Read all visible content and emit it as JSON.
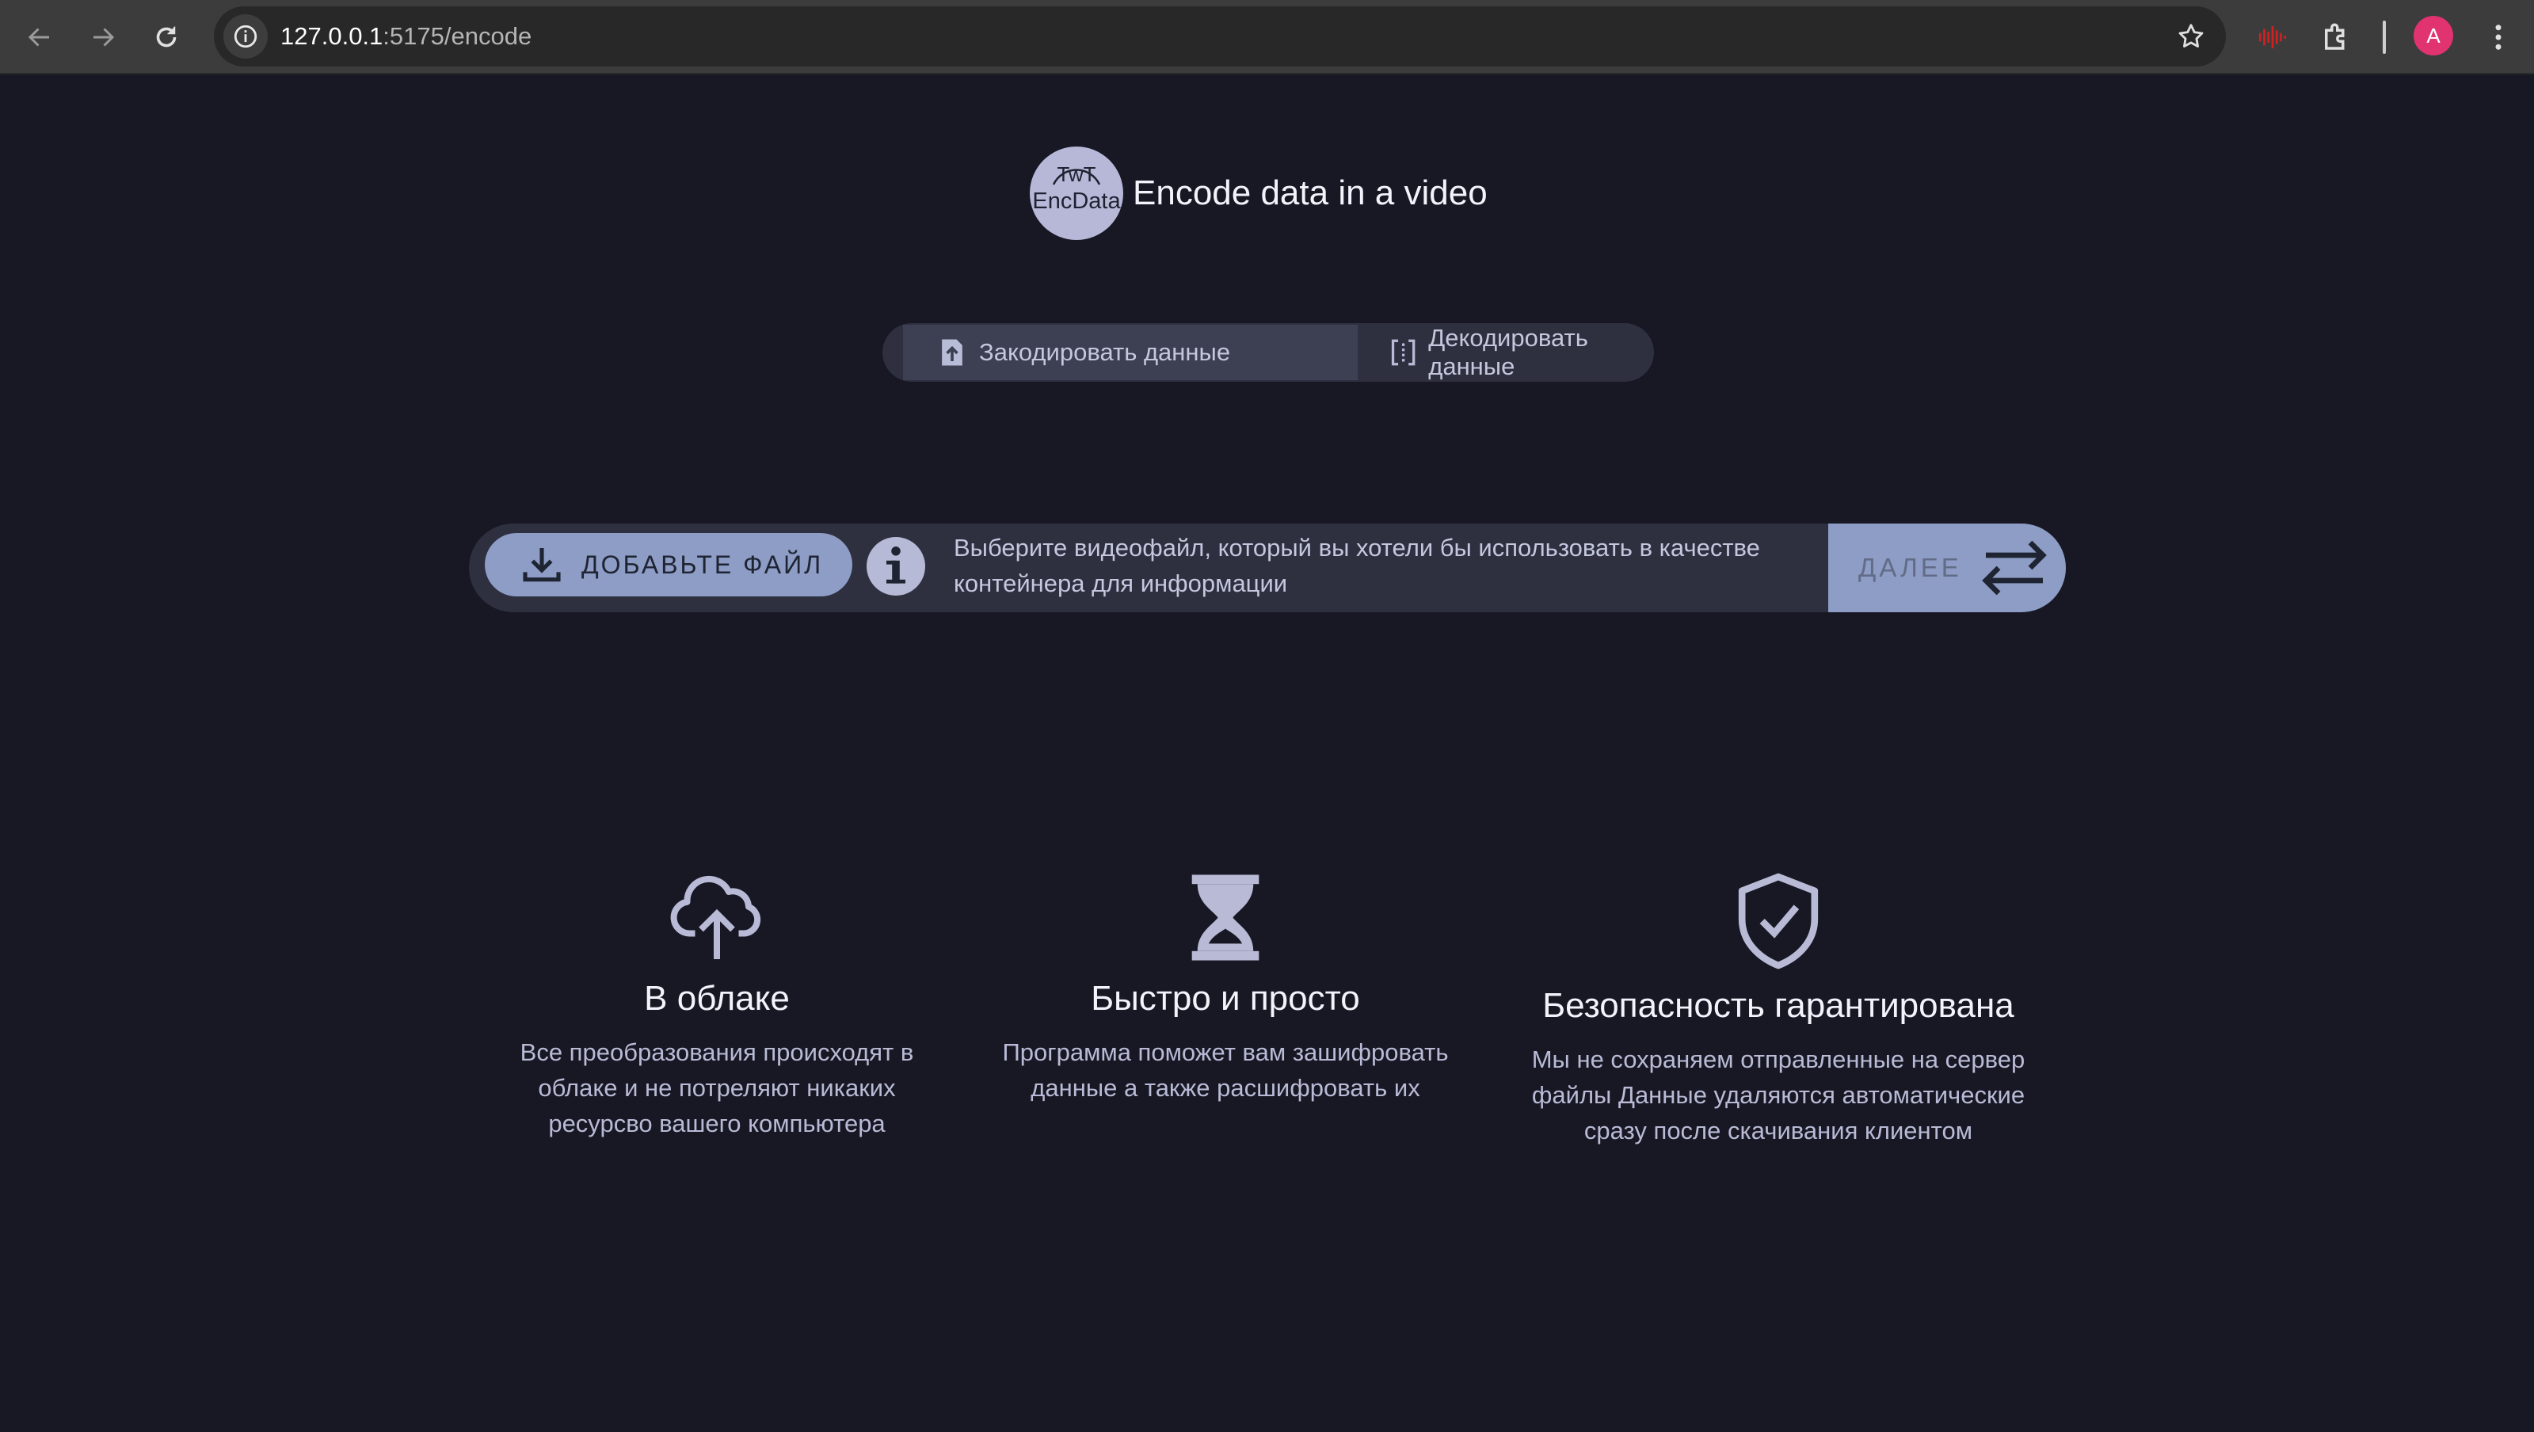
{
  "browser": {
    "url_host": "127.0.0.1",
    "url_path": ":5175/encode",
    "profile_initial": "A"
  },
  "header": {
    "logo_top": "TwT",
    "logo_bottom": "EncData",
    "title": "Encode data in a video"
  },
  "mode_tabs": {
    "encode_label": "Закодировать данные",
    "decode_label": "Декодировать данные"
  },
  "upload": {
    "add_file_label": "ДОБАВЬТЕ ФАЙЛ",
    "hint": "Выберите видеофайл, который вы хотели бы использовать в качестве контейнера для информации",
    "next_label": "ДАЛЕЕ"
  },
  "features": [
    {
      "title": "В облаке",
      "text": "Все преобразования происходят в облаке и не потреляют никаких ресурсво вашего компьютера"
    },
    {
      "title": "Быстро и просто",
      "text": "Программа поможет вам зашифровать данные а также расшифровать их"
    },
    {
      "title": "Безопасность гарантирована",
      "text": "Мы не сохраняем отправленные на сервер файлы Данные удаляются автоматические сразу после скачивания клиентом"
    }
  ],
  "colors": {
    "page_bg": "#171824",
    "accent": "#8e9dc6",
    "panel": "#2e3040"
  }
}
